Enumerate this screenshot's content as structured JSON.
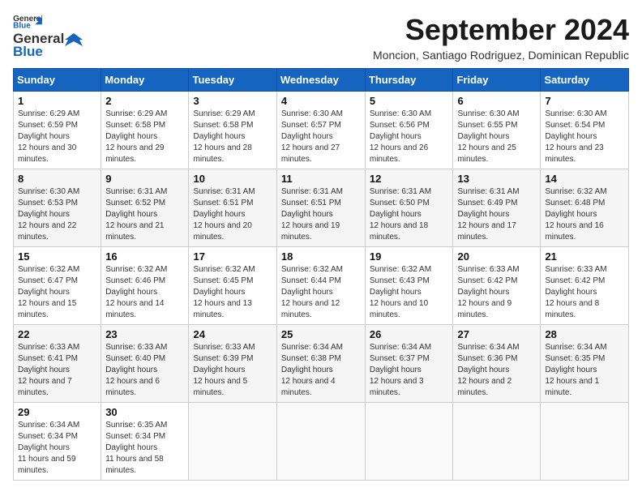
{
  "logo": {
    "line1": "General",
    "line2": "Blue"
  },
  "header": {
    "month_year": "September 2024",
    "location": "Moncion, Santiago Rodriguez, Dominican Republic"
  },
  "weekdays": [
    "Sunday",
    "Monday",
    "Tuesday",
    "Wednesday",
    "Thursday",
    "Friday",
    "Saturday"
  ],
  "weeks": [
    [
      {
        "day": "1",
        "sunrise": "6:29 AM",
        "sunset": "6:59 PM",
        "daylight": "12 hours and 30 minutes."
      },
      {
        "day": "2",
        "sunrise": "6:29 AM",
        "sunset": "6:58 PM",
        "daylight": "12 hours and 29 minutes."
      },
      {
        "day": "3",
        "sunrise": "6:29 AM",
        "sunset": "6:58 PM",
        "daylight": "12 hours and 28 minutes."
      },
      {
        "day": "4",
        "sunrise": "6:30 AM",
        "sunset": "6:57 PM",
        "daylight": "12 hours and 27 minutes."
      },
      {
        "day": "5",
        "sunrise": "6:30 AM",
        "sunset": "6:56 PM",
        "daylight": "12 hours and 26 minutes."
      },
      {
        "day": "6",
        "sunrise": "6:30 AM",
        "sunset": "6:55 PM",
        "daylight": "12 hours and 25 minutes."
      },
      {
        "day": "7",
        "sunrise": "6:30 AM",
        "sunset": "6:54 PM",
        "daylight": "12 hours and 23 minutes."
      }
    ],
    [
      {
        "day": "8",
        "sunrise": "6:30 AM",
        "sunset": "6:53 PM",
        "daylight": "12 hours and 22 minutes."
      },
      {
        "day": "9",
        "sunrise": "6:31 AM",
        "sunset": "6:52 PM",
        "daylight": "12 hours and 21 minutes."
      },
      {
        "day": "10",
        "sunrise": "6:31 AM",
        "sunset": "6:51 PM",
        "daylight": "12 hours and 20 minutes."
      },
      {
        "day": "11",
        "sunrise": "6:31 AM",
        "sunset": "6:51 PM",
        "daylight": "12 hours and 19 minutes."
      },
      {
        "day": "12",
        "sunrise": "6:31 AM",
        "sunset": "6:50 PM",
        "daylight": "12 hours and 18 minutes."
      },
      {
        "day": "13",
        "sunrise": "6:31 AM",
        "sunset": "6:49 PM",
        "daylight": "12 hours and 17 minutes."
      },
      {
        "day": "14",
        "sunrise": "6:32 AM",
        "sunset": "6:48 PM",
        "daylight": "12 hours and 16 minutes."
      }
    ],
    [
      {
        "day": "15",
        "sunrise": "6:32 AM",
        "sunset": "6:47 PM",
        "daylight": "12 hours and 15 minutes."
      },
      {
        "day": "16",
        "sunrise": "6:32 AM",
        "sunset": "6:46 PM",
        "daylight": "12 hours and 14 minutes."
      },
      {
        "day": "17",
        "sunrise": "6:32 AM",
        "sunset": "6:45 PM",
        "daylight": "12 hours and 13 minutes."
      },
      {
        "day": "18",
        "sunrise": "6:32 AM",
        "sunset": "6:44 PM",
        "daylight": "12 hours and 12 minutes."
      },
      {
        "day": "19",
        "sunrise": "6:32 AM",
        "sunset": "6:43 PM",
        "daylight": "12 hours and 10 minutes."
      },
      {
        "day": "20",
        "sunrise": "6:33 AM",
        "sunset": "6:42 PM",
        "daylight": "12 hours and 9 minutes."
      },
      {
        "day": "21",
        "sunrise": "6:33 AM",
        "sunset": "6:42 PM",
        "daylight": "12 hours and 8 minutes."
      }
    ],
    [
      {
        "day": "22",
        "sunrise": "6:33 AM",
        "sunset": "6:41 PM",
        "daylight": "12 hours and 7 minutes."
      },
      {
        "day": "23",
        "sunrise": "6:33 AM",
        "sunset": "6:40 PM",
        "daylight": "12 hours and 6 minutes."
      },
      {
        "day": "24",
        "sunrise": "6:33 AM",
        "sunset": "6:39 PM",
        "daylight": "12 hours and 5 minutes."
      },
      {
        "day": "25",
        "sunrise": "6:34 AM",
        "sunset": "6:38 PM",
        "daylight": "12 hours and 4 minutes."
      },
      {
        "day": "26",
        "sunrise": "6:34 AM",
        "sunset": "6:37 PM",
        "daylight": "12 hours and 3 minutes."
      },
      {
        "day": "27",
        "sunrise": "6:34 AM",
        "sunset": "6:36 PM",
        "daylight": "12 hours and 2 minutes."
      },
      {
        "day": "28",
        "sunrise": "6:34 AM",
        "sunset": "6:35 PM",
        "daylight": "12 hours and 1 minute."
      }
    ],
    [
      {
        "day": "29",
        "sunrise": "6:34 AM",
        "sunset": "6:34 PM",
        "daylight": "11 hours and 59 minutes."
      },
      {
        "day": "30",
        "sunrise": "6:35 AM",
        "sunset": "6:34 PM",
        "daylight": "11 hours and 58 minutes."
      },
      null,
      null,
      null,
      null,
      null
    ]
  ],
  "labels": {
    "sunrise": "Sunrise: ",
    "sunset": "Sunset: ",
    "daylight": "Daylight hours"
  }
}
